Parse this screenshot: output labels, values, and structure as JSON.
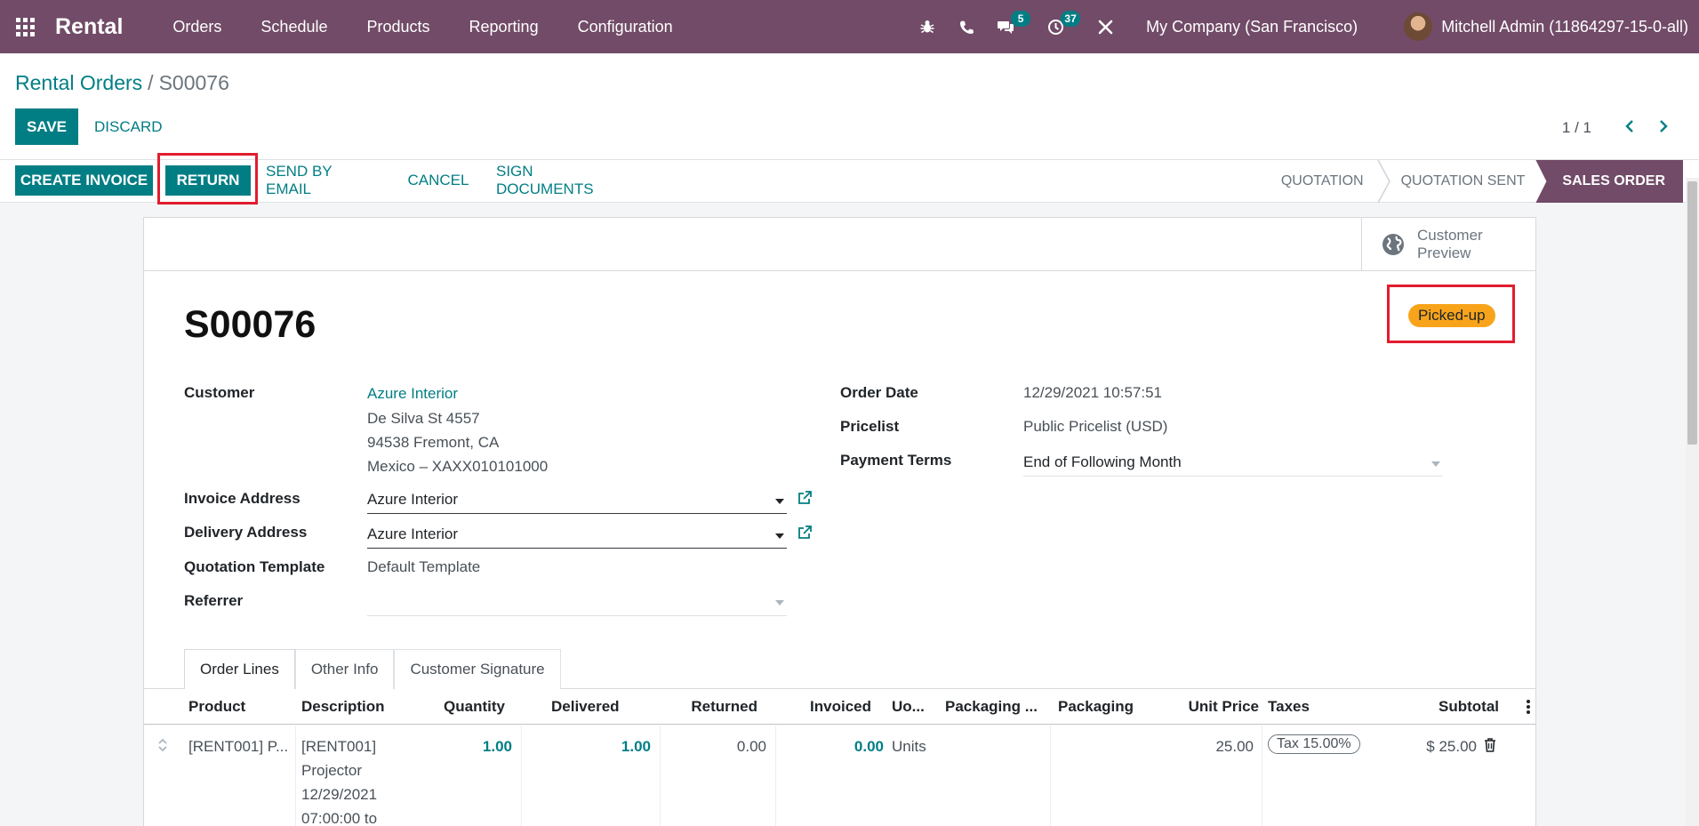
{
  "navbar": {
    "brand": "Rental",
    "menu": [
      "Orders",
      "Schedule",
      "Products",
      "Reporting",
      "Configuration"
    ],
    "messages_count": "5",
    "activities_count": "37",
    "company": "My Company (San Francisco)",
    "user": "Mitchell Admin (11864297-15-0-all)",
    "accent": "#714b67"
  },
  "control": {
    "breadcrumb_parent": "Rental Orders",
    "breadcrumb_sep": "/",
    "breadcrumb_current": "S00076",
    "save_label": "SAVE",
    "discard_label": "DISCARD",
    "pager": "1 / 1"
  },
  "statusbar": {
    "buttons": [
      "CREATE INVOICE",
      "RETURN",
      "SEND BY EMAIL",
      "CANCEL",
      "SIGN DOCUMENTS"
    ],
    "stages": [
      "QUOTATION",
      "QUOTATION SENT",
      "SALES ORDER"
    ],
    "active_stage": "SALES ORDER",
    "primary_color": "#017e84"
  },
  "form": {
    "preview_label": "Customer Preview",
    "title": "S00076",
    "ribbon": "Picked-up",
    "left": {
      "customer_label": "Customer",
      "customer_name": "Azure Interior",
      "customer_addr1": "De Silva St 4557",
      "customer_addr2": "94538 Fremont, CA",
      "customer_addr3": "Mexico – XAXX010101000",
      "invoice_label": "Invoice Address",
      "invoice_value": "Azure Interior",
      "delivery_label": "Delivery Address",
      "delivery_value": "Azure Interior",
      "template_label": "Quotation Template",
      "template_value": "Default Template",
      "referrer_label": "Referrer"
    },
    "right": {
      "order_date_label": "Order Date",
      "order_date_value": "12/29/2021 10:57:51",
      "pricelist_label": "Pricelist",
      "pricelist_value": "Public Pricelist (USD)",
      "payment_label": "Payment Terms",
      "payment_value": "End of Following Month"
    },
    "tabs": [
      "Order Lines",
      "Other Info",
      "Customer Signature"
    ]
  },
  "table": {
    "headers": [
      "Product",
      "Description",
      "Quantity",
      "Delivered",
      "Returned",
      "Invoiced",
      "Uo...",
      "Packaging ...",
      "Packaging",
      "Unit Price",
      "Taxes",
      "Subtotal"
    ],
    "row": {
      "product": "[RENT001] P...",
      "description": [
        "[RENT001]",
        "Projector",
        "12/29/2021",
        "07:00:00 to"
      ],
      "quantity": "1.00",
      "delivered": "1.00",
      "returned": "0.00",
      "invoiced": "0.00",
      "uom": "Units",
      "unit_price": "25.00",
      "tax": "Tax 15.00%",
      "subtotal": "$ 25.00"
    }
  }
}
